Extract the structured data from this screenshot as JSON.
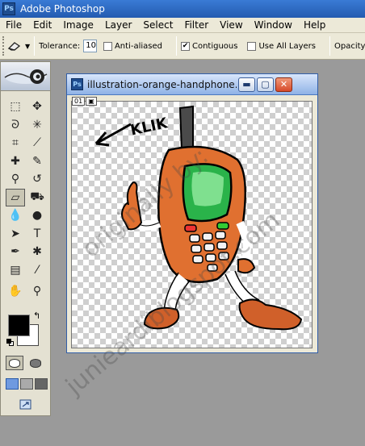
{
  "app": {
    "title": "Adobe Photoshop",
    "icon_letters": "Ps"
  },
  "menu": [
    "File",
    "Edit",
    "Image",
    "Layer",
    "Select",
    "Filter",
    "View",
    "Window",
    "Help"
  ],
  "options": {
    "tolerance_label": "Tolerance:",
    "tolerance_value": "10",
    "anti_aliased": {
      "label": "Anti-aliased",
      "checked": false
    },
    "contiguous": {
      "label": "Contiguous",
      "checked": true
    },
    "use_all_layers": {
      "label": "Use All Layers",
      "checked": false
    },
    "opacity_label": "Opacity:"
  },
  "toolbox": {
    "tools": [
      {
        "name": "marquee-tool-icon",
        "glyph": "⬚"
      },
      {
        "name": "move-tool-icon",
        "glyph": "✥"
      },
      {
        "name": "lasso-tool-icon",
        "glyph": "ᘐ"
      },
      {
        "name": "magic-wand-tool-icon",
        "glyph": "✳"
      },
      {
        "name": "crop-tool-icon",
        "glyph": "⌗"
      },
      {
        "name": "slice-tool-icon",
        "glyph": "⟋"
      },
      {
        "name": "healing-brush-tool-icon",
        "glyph": "✚"
      },
      {
        "name": "brush-tool-icon",
        "glyph": "✎"
      },
      {
        "name": "clone-stamp-tool-icon",
        "glyph": "⚲"
      },
      {
        "name": "history-brush-tool-icon",
        "glyph": "↺"
      },
      {
        "name": "eraser-tool-icon",
        "glyph": "▱"
      },
      {
        "name": "paint-bucket-tool-icon",
        "glyph": "⛟"
      },
      {
        "name": "blur-tool-icon",
        "glyph": "💧"
      },
      {
        "name": "dodge-tool-icon",
        "glyph": "●"
      },
      {
        "name": "path-selection-tool-icon",
        "glyph": "➤"
      },
      {
        "name": "type-tool-icon",
        "glyph": "T"
      },
      {
        "name": "pen-tool-icon",
        "glyph": "✒"
      },
      {
        "name": "custom-shape-tool-icon",
        "glyph": "✱"
      },
      {
        "name": "notes-tool-icon",
        "glyph": "▤"
      },
      {
        "name": "eyedropper-tool-icon",
        "glyph": "⁄"
      },
      {
        "name": "hand-tool-icon",
        "glyph": "✋"
      },
      {
        "name": "zoom-tool-icon",
        "glyph": "⚲"
      }
    ],
    "foreground_color": "#000000",
    "background_color": "#ffffff"
  },
  "document": {
    "title": "illustration-orange-handphone...",
    "icon_letters": "Ps",
    "layer_badges": [
      "01",
      "▣"
    ],
    "drawing_text": "KLIK"
  },
  "watermark": {
    "line1": "originally by:",
    "line2": "junieardiblogspot.com"
  }
}
